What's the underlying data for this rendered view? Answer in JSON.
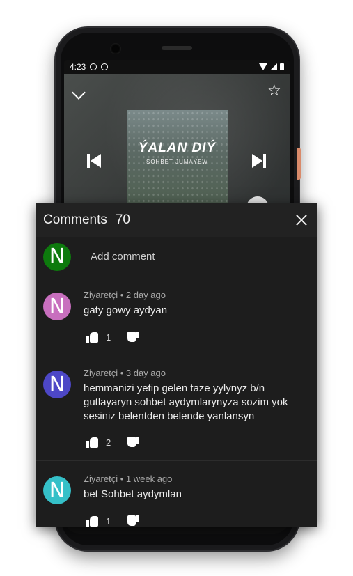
{
  "status_bar": {
    "time": "4:23"
  },
  "player": {
    "cover_title": "ÝALAN DIÝ",
    "cover_subtitle": "SOHBET JUMAÝEW"
  },
  "comments_sheet": {
    "title": "Comments",
    "count": "70",
    "add_comment": {
      "avatar_letter": "N",
      "avatar_color": "#0d7a0d",
      "label": "Add comment"
    },
    "items": [
      {
        "avatar_letter": "N",
        "avatar_color": "#c86fbe",
        "meta": "Ziyaretçi • 2 day ago",
        "text": "gaty gowy aydyan",
        "likes": "1"
      },
      {
        "avatar_letter": "N",
        "avatar_color": "#4d47c6",
        "meta": "Ziyaretçi • 3 day ago",
        "text": "hemmanizi yetip gelen taze yylynyz b/n gutlayaryn sohbet aydymlarynyza sozim yok sesiniz belentden belende yanlansyn",
        "likes": "2"
      },
      {
        "avatar_letter": "N",
        "avatar_color": "#35c0c8",
        "meta": "Ziyaretçi • 1 week ago",
        "text": "bet Sohbet aydymlan",
        "likes": "1"
      }
    ]
  }
}
